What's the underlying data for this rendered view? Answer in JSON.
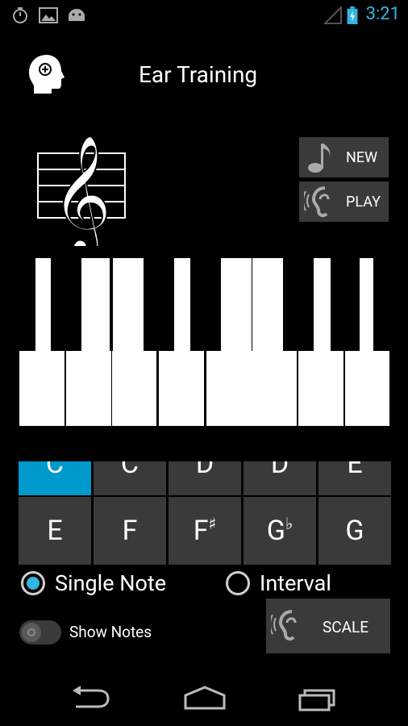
{
  "status_bar": {
    "time": "3:21",
    "icons": [
      "timer-icon",
      "image-icon",
      "android-icon",
      "signal-icon",
      "battery-charging-icon"
    ],
    "accent": "#33b5e5"
  },
  "app": {
    "title": "Ear Training",
    "icon": "head-plus-icon"
  },
  "buttons": {
    "new_label": "NEW",
    "play_label": "PLAY",
    "scale_label": "SCALE"
  },
  "note_grid": {
    "row1": [
      "C",
      "C",
      "D",
      "D",
      "E"
    ],
    "row2": [
      "E",
      "F",
      "F",
      "G",
      "G"
    ],
    "row2_accidentals": [
      "",
      "",
      "♯",
      "♭",
      ""
    ],
    "selected_index": 0,
    "selected_color": "#0099cc"
  },
  "mode": {
    "options": [
      "Single Note",
      "Interval"
    ],
    "selected": "Single Note"
  },
  "show_notes": {
    "label": "Show Notes",
    "on": false
  },
  "nav": [
    "back-icon",
    "home-icon",
    "recents-icon"
  ]
}
